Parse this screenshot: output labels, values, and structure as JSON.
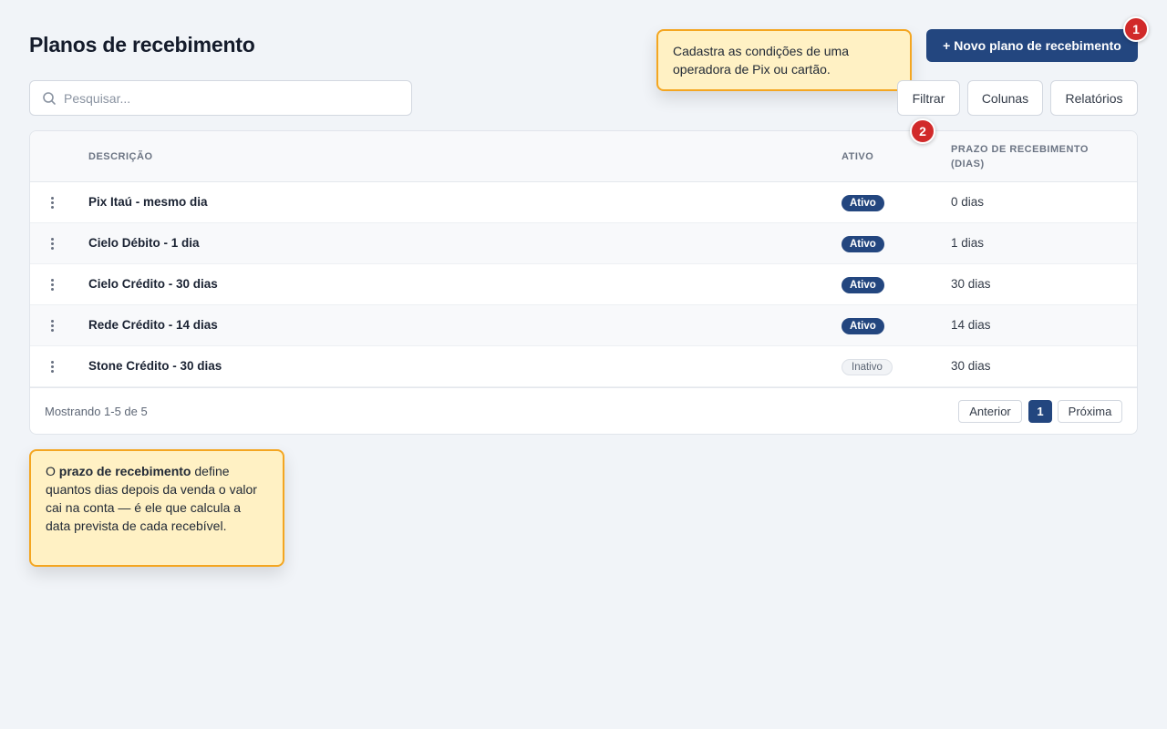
{
  "page": {
    "title": "Planos de recebimento",
    "new_button": "+ Novo plano de recebimento"
  },
  "steps": [
    "1",
    "2"
  ],
  "tooltips": {
    "top": "Cadastra as condições de uma operadora de Pix ou cartão.",
    "bottom_prefix": "O ",
    "bottom_bold": "prazo de recebimento",
    "bottom_suffix": " define quantos dias depois da venda o valor cai na conta — é ele que calcula a data prevista de cada recebível."
  },
  "search": {
    "placeholder": "Pesquisar...",
    "value": ""
  },
  "toolbar": {
    "filter": "Filtrar",
    "columns": "Colunas",
    "reports": "Relatórios"
  },
  "table": {
    "headers": {
      "description": "DESCRIÇÃO",
      "active": "ATIVO",
      "term": "PRAZO DE RECEBIMENTO (DIAS)"
    },
    "rows": [
      {
        "description": "Pix Itaú - mesmo dia",
        "status": "Ativo",
        "term": "0 dias"
      },
      {
        "description": "Cielo Débito - 1 dia",
        "status": "Ativo",
        "term": "1 dias"
      },
      {
        "description": "Cielo Crédito - 30 dias",
        "status": "Ativo",
        "term": "30 dias"
      },
      {
        "description": "Rede Crédito - 14 dias",
        "status": "Ativo",
        "term": "14 dias"
      },
      {
        "description": "Stone Crédito - 30 dias",
        "status": "Inativo",
        "term": "30 dias"
      }
    ]
  },
  "pagination": {
    "showing": "Mostrando 1-5 de 5",
    "previous": "Anterior",
    "current": "1",
    "next": "Próxima"
  },
  "colors": {
    "primary": "#23467f",
    "badge": "#d12a2a",
    "tooltip_bg": "#fff1c4",
    "tooltip_border": "#f4a621",
    "background": "#f1f4f8"
  }
}
